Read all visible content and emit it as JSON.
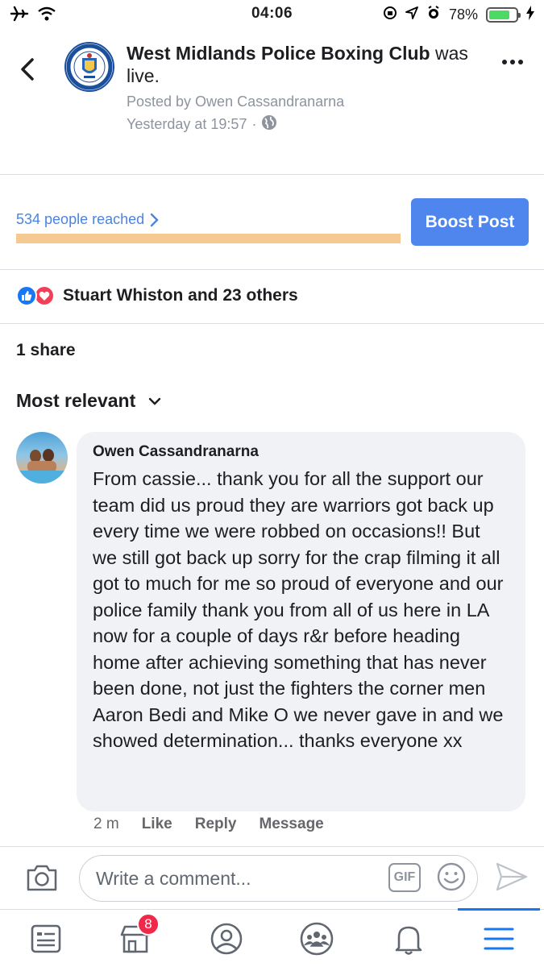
{
  "status_bar": {
    "time": "04:06",
    "battery_percent": "78%",
    "battery_level": 0.78
  },
  "post": {
    "page_name": "West Midlands Police Boxing Club",
    "action_text": " was live.",
    "posted_by": "Posted by Owen Cassandranarna",
    "timestamp": "Yesterday at 19:57",
    "separator": "·"
  },
  "insights": {
    "reach_text": "534 people reached",
    "boost_label": "Boost Post"
  },
  "reactions": {
    "text": "Stuart Whiston and 23 others"
  },
  "shares_text": "1 share",
  "comment_filter": "Most relevant",
  "comment": {
    "author": "Owen Cassandranarna",
    "text": "From cassie... thank you for all the support our team did us proud they are warriors got back up every time we were robbed on occasions!! But we still got back up sorry for the crap filming it all got to much for me so proud of everyone and our police family thank you from all of us here in LA now for a couple of days r&r before heading home after achieving something that has never been done, not just the fighters the corner men  Aaron Bedi and Mike O we never gave in and we showed determination... thanks everyone xx",
    "time": "2 m",
    "like_label": "Like",
    "reply_label": "Reply",
    "message_label": "Message"
  },
  "composer": {
    "placeholder": "Write a comment...",
    "gif_label": "GIF"
  },
  "bottom_nav": {
    "marketplace_badge": "8",
    "active_tab": "menu"
  },
  "colors": {
    "accent": "#4e86ee",
    "reach_link": "#4b84e0",
    "reach_bar": "#f6c992",
    "badge": "#f02849"
  }
}
